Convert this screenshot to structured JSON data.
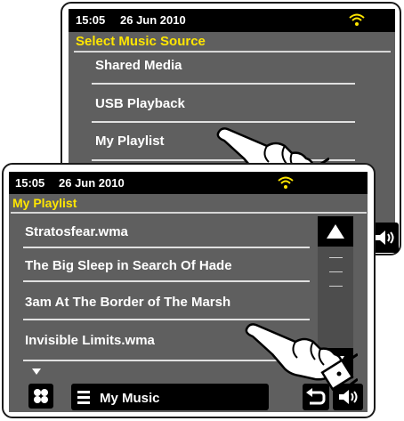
{
  "back_screen": {
    "status": {
      "time": "15:05",
      "date": "26 Jun 2010"
    },
    "title": "Select Music Source",
    "items": [
      {
        "label": "Shared Media"
      },
      {
        "label": "USB Playback"
      },
      {
        "label": "My Playlist"
      }
    ]
  },
  "front_screen": {
    "status": {
      "time": "15:05",
      "date": "26 Jun 2010"
    },
    "title": "My Playlist",
    "items": [
      {
        "label": "Stratosfear.wma"
      },
      {
        "label": "The Big Sleep in Search Of Hade"
      },
      {
        "label": "3am At The Border of The Marsh"
      },
      {
        "label": "Invisible Limits.wma"
      }
    ],
    "bottom_bar": {
      "music_label": "My Music"
    }
  },
  "colors": {
    "screen_bg": "#5f5f5f",
    "title_yellow": "#ffe600",
    "wifi_yellow": "#ffe600",
    "status_bg": "#000000"
  },
  "icons": [
    "wifi-icon",
    "scroll-up-icon",
    "scroll-down-icon",
    "home-icon",
    "menu-icon",
    "back-icon",
    "speaker-icon",
    "pointing-hand-icon"
  ]
}
